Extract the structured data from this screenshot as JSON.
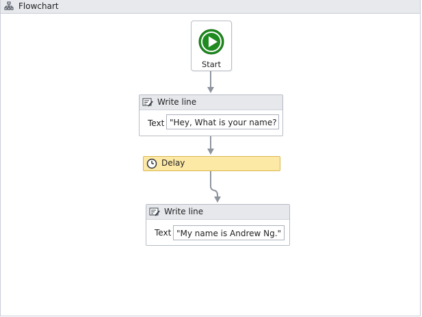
{
  "panel": {
    "title": "Flowchart",
    "title_icon": "flowchart-icon"
  },
  "start_node": {
    "label": "Start",
    "icon": "play-icon",
    "icon_color": "#1f8a1f"
  },
  "activities": [
    {
      "title": "Write line",
      "icon": "write-line-icon",
      "field_label": "Text",
      "field_value": "\"Hey, What is your name? \""
    },
    {
      "title": "Delay",
      "icon": "clock-icon",
      "highlight_color": "#fde9a6"
    },
    {
      "title": "Write line",
      "icon": "write-line-icon",
      "field_label": "Text",
      "field_value": "\"My name is Andrew Ng.\""
    }
  ],
  "colors": {
    "connector": "#8e949e",
    "header_bg": "#e6e8ec",
    "delay_border": "#d9b64a"
  }
}
